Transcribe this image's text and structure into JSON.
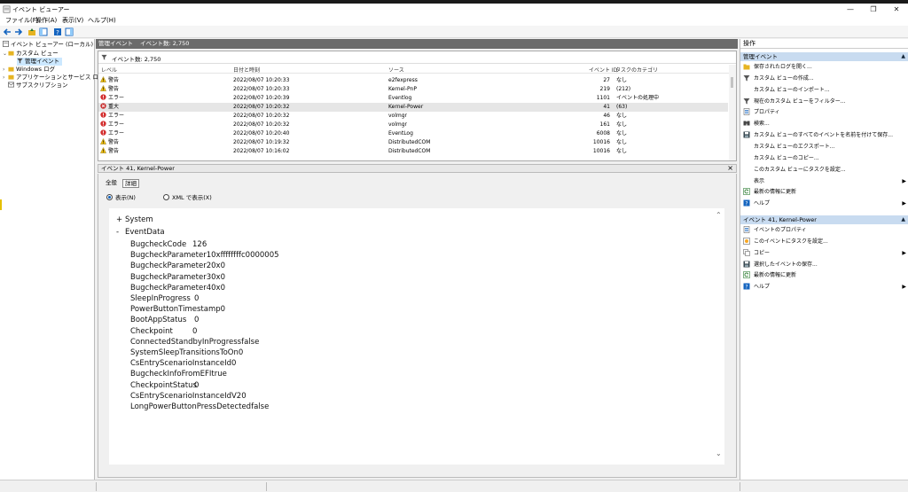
{
  "window": {
    "title": "イベント ビューアー",
    "controls": {
      "minimize": "—",
      "maximize": "❐",
      "close": "✕"
    }
  },
  "menu": {
    "items": [
      "ファイル(F)",
      "操作(A)",
      "表示(V)",
      "ヘルプ(H)"
    ]
  },
  "tree": {
    "items": [
      {
        "label": "イベント ビューアー (ローカル)"
      },
      {
        "label": "カスタム ビュー"
      },
      {
        "label": "管理イベント"
      },
      {
        "label": "Windows ログ"
      },
      {
        "label": "アプリケーションとサービス ログ"
      },
      {
        "label": "サブスクリプション"
      }
    ]
  },
  "center": {
    "header_title": "管理イベント",
    "header_count": "イベント数: 2,750",
    "filter_text": "イベント数: 2,750",
    "columns": [
      "レベル",
      "日付と時刻",
      "ソース",
      "イベント ID",
      "タスクのカテゴリ"
    ],
    "rows": [
      {
        "level": "警告",
        "kind": "warning",
        "datetime": "2022/08/07 10:20:33",
        "source": "e2fexpress",
        "id": "27",
        "category": "なし"
      },
      {
        "level": "警告",
        "kind": "warning",
        "datetime": "2022/08/07 10:20:33",
        "source": "Kernel-PnP",
        "id": "219",
        "category": "(212)"
      },
      {
        "level": "エラー",
        "kind": "error",
        "datetime": "2022/08/07 10:20:39",
        "source": "Eventlog",
        "id": "1101",
        "category": "イベントの処理中"
      },
      {
        "level": "重大",
        "kind": "critical",
        "datetime": "2022/08/07 10:20:32",
        "source": "Kernel-Power",
        "id": "41",
        "category": "(63)"
      },
      {
        "level": "エラー",
        "kind": "error",
        "datetime": "2022/08/07 10:20:32",
        "source": "volmgr",
        "id": "46",
        "category": "なし"
      },
      {
        "level": "エラー",
        "kind": "error",
        "datetime": "2022/08/07 10:20:32",
        "source": "volmgr",
        "id": "161",
        "category": "なし"
      },
      {
        "level": "エラー",
        "kind": "error",
        "datetime": "2022/08/07 10:20:40",
        "source": "EventLog",
        "id": "6008",
        "category": "なし"
      },
      {
        "level": "警告",
        "kind": "warning",
        "datetime": "2022/08/07 10:19:32",
        "source": "DistributedCOM",
        "id": "10016",
        "category": "なし"
      },
      {
        "level": "警告",
        "kind": "warning",
        "datetime": "2022/08/07 10:16:02",
        "source": "DistributedCOM",
        "id": "10016",
        "category": "なし"
      }
    ]
  },
  "detail": {
    "title": "イベント 41, Kernel-Power",
    "close": "×",
    "tabs": [
      "全般",
      "詳細"
    ],
    "radio_friendly": "表示(N)",
    "radio_xml": "XML で表示(X)",
    "system_node": "System",
    "eventdata_node": "EventData",
    "system_toggle": "+",
    "eventdata_toggle": "-",
    "fields": [
      {
        "key": "BugcheckCode",
        "value": "126"
      },
      {
        "key": "BugcheckParameter1",
        "value": "0xffffffffc0000005"
      },
      {
        "key": "BugcheckParameter2",
        "value": "0x0"
      },
      {
        "key": "BugcheckParameter3",
        "value": "0x0"
      },
      {
        "key": "BugcheckParameter4",
        "value": "0x0"
      },
      {
        "key": "SleepInProgress",
        "value": "0"
      },
      {
        "key": "PowerButtonTimestamp",
        "value": "0"
      },
      {
        "key": "BootAppStatus",
        "value": "0"
      },
      {
        "key": "Checkpoint",
        "value": "0"
      },
      {
        "key": "ConnectedStandbyInProgress",
        "value": "false"
      },
      {
        "key": "SystemSleepTransitionsToOn",
        "value": "0"
      },
      {
        "key": "CsEntryScenarioInstanceId",
        "value": "0"
      },
      {
        "key": "BugcheckInfoFromEFI",
        "value": "true"
      },
      {
        "key": "CheckpointStatus",
        "value": "0"
      },
      {
        "key": "CsEntryScenarioInstanceIdV2",
        "value": "0"
      },
      {
        "key": "LongPowerButtonPressDetected",
        "value": "false"
      }
    ]
  },
  "actions": {
    "title": "操作",
    "section1": "管理イベント",
    "section1_items": [
      {
        "label": "保存されたログを開く...",
        "icon": "folder-icon",
        "arrow": ""
      },
      {
        "label": "カスタム ビューの作成...",
        "icon": "filter-icon",
        "arrow": ""
      },
      {
        "label": "カスタム ビューのインポート...",
        "icon": "",
        "arrow": ""
      },
      {
        "label": "現在のカスタム ビューをフィルター...",
        "icon": "filter-icon",
        "arrow": ""
      },
      {
        "label": "プロパティ",
        "icon": "properties-icon",
        "arrow": ""
      },
      {
        "label": "検索...",
        "icon": "find-icon",
        "arrow": ""
      },
      {
        "label": "カスタム ビューのすべてのイベントを名前を付けて保存...",
        "icon": "save-icon",
        "arrow": ""
      },
      {
        "label": "カスタム ビューのエクスポート...",
        "icon": "",
        "arrow": ""
      },
      {
        "label": "カスタム ビューのコピー...",
        "icon": "",
        "arrow": ""
      },
      {
        "label": "このカスタム ビューにタスクを設定...",
        "icon": "",
        "arrow": ""
      },
      {
        "label": "表示",
        "icon": "",
        "arrow": "▶"
      },
      {
        "label": "最新の情報に更新",
        "icon": "refresh-icon",
        "arrow": ""
      },
      {
        "label": "ヘルプ",
        "icon": "help-icon",
        "arrow": "▶"
      }
    ],
    "section2": "イベント 41, Kernel-Power",
    "section2_items": [
      {
        "label": "イベントのプロパティ",
        "icon": "properties-icon",
        "arrow": ""
      },
      {
        "label": "このイベントにタスクを設定...",
        "icon": "task-icon",
        "arrow": ""
      },
      {
        "label": "コピー",
        "icon": "copy-icon",
        "arrow": "▶"
      },
      {
        "label": "選択したイベントの保存...",
        "icon": "save-icon",
        "arrow": ""
      },
      {
        "label": "最新の情報に更新",
        "icon": "refresh-icon",
        "arrow": ""
      },
      {
        "label": "ヘルプ",
        "icon": "help-icon",
        "arrow": "▶"
      }
    ],
    "collapse_glyph": "▲"
  },
  "colors": {
    "warning": "#f4c20d",
    "error": "#d32f2f",
    "critical": "#c62828",
    "accent": "#0a5fbd",
    "section_bg": "#c8dbf0"
  }
}
